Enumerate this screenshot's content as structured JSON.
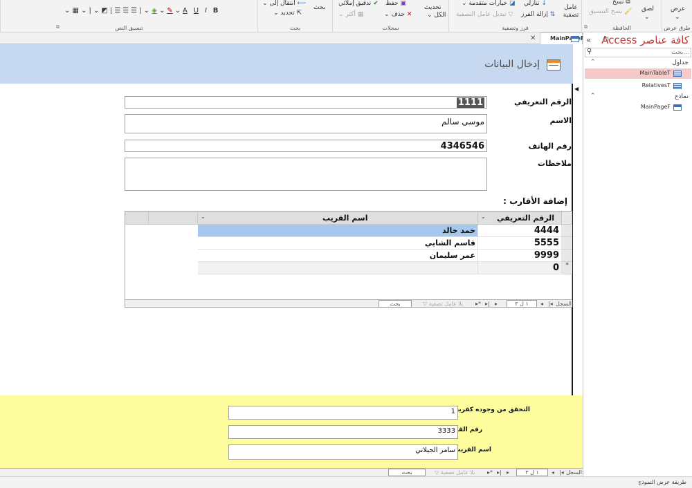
{
  "ribbon": {
    "groups": {
      "views": {
        "label": "طرق عرض",
        "view_label": "عرض"
      },
      "clipboard": {
        "label": "الحافظة",
        "paste_label": "لصق",
        "copy_label": "نسخ",
        "format_painter_label": "نسخ التنسيق"
      },
      "sort_filter": {
        "label": "فرز وتصفية",
        "filter_label": "عامل تصفية",
        "descending_label": "تنازلي",
        "advanced_label": "خيارات متقدمة",
        "remove_sort_label": "إزالة الفرز",
        "toggle_filter_label": "تبديل عامل التصفية"
      },
      "records": {
        "label": "سجلات",
        "refresh_label": "تحديث",
        "refresh_sub": "الكل",
        "save_label": "حفظ",
        "spelling_label": "تدقيق إملائي",
        "delete_label": "حذف",
        "more_label": "أكثر"
      },
      "find": {
        "label": "بحث",
        "find_label": "بحث",
        "goto_label": "انتقال إلى",
        "select_label": "تحديد"
      },
      "text_formatting": {
        "label": "تنسيق النص",
        "bold": "B",
        "italic": "I",
        "underline": "U",
        "font_color_letter": "A"
      }
    }
  },
  "nav_pane": {
    "title": "كافة عناصر Access",
    "search_placeholder": "بحث...",
    "categories": [
      {
        "label": "جداول",
        "items": [
          {
            "label": "MainTableT",
            "selected": true
          },
          {
            "label": "RelativesT",
            "selected": false
          }
        ]
      },
      {
        "label": "نماذج",
        "items": [
          {
            "label": "MainPageF",
            "selected": false
          }
        ]
      }
    ]
  },
  "document_tab": {
    "label": "MainPageF"
  },
  "form": {
    "title": "إدخال البيانات",
    "fields": {
      "id": {
        "label": "الرقم التعريفي",
        "value": "1111"
      },
      "name": {
        "label": "الاسم",
        "value": "موسى سالم"
      },
      "phone": {
        "label": "رقم الهاتف",
        "value": "4346546"
      },
      "notes": {
        "label": "ملاحظات",
        "value": ""
      }
    },
    "relatives_label": "إضافة الأقارب :",
    "subform": {
      "columns": {
        "id": "الرقم التعريفي",
        "name": "اسم القريب"
      },
      "rows": [
        {
          "id": "4444",
          "name": "حمد خالد"
        },
        {
          "id": "5555",
          "name": "قاسم الشابي"
        },
        {
          "id": "9999",
          "name": "عمر سليمان"
        },
        {
          "id": "0",
          "name": ""
        }
      ],
      "new_row_marker": "*",
      "navigator": {
        "prefix": "السجل:",
        "position": "١ ل ٣",
        "filter_status": "بلا عامل تصفية",
        "search": "بحث"
      }
    },
    "footer": {
      "check_label": "التحقق من وجوده كقريب",
      "check_value": "1",
      "relative_id_label": "رقم القريب",
      "relative_id_value": "3333",
      "relative_name_label": "اسم القريب",
      "relative_name_value": "سامر الجيلاني"
    },
    "navigator": {
      "prefix": "السجل:",
      "position": "١ ل ٣",
      "filter_status": "بلا عامل تصفية",
      "search": "بحث"
    }
  },
  "status_bar": {
    "text": "طريقة عرض النموذج"
  },
  "colors": {
    "header_band": "#c6d9f1",
    "footer_band": "#fdfd9e",
    "nav_title": "#b83b3b",
    "selected_nav": "#f7c9c9",
    "selected_row": "#a6c8ec"
  },
  "icons": [
    "search-icon",
    "table-icon",
    "form-icon",
    "close-icon",
    "chevron-icon",
    "filter-icon",
    "first-record-icon",
    "prev-record-icon",
    "next-record-icon",
    "last-record-icon",
    "new-record-icon"
  ]
}
